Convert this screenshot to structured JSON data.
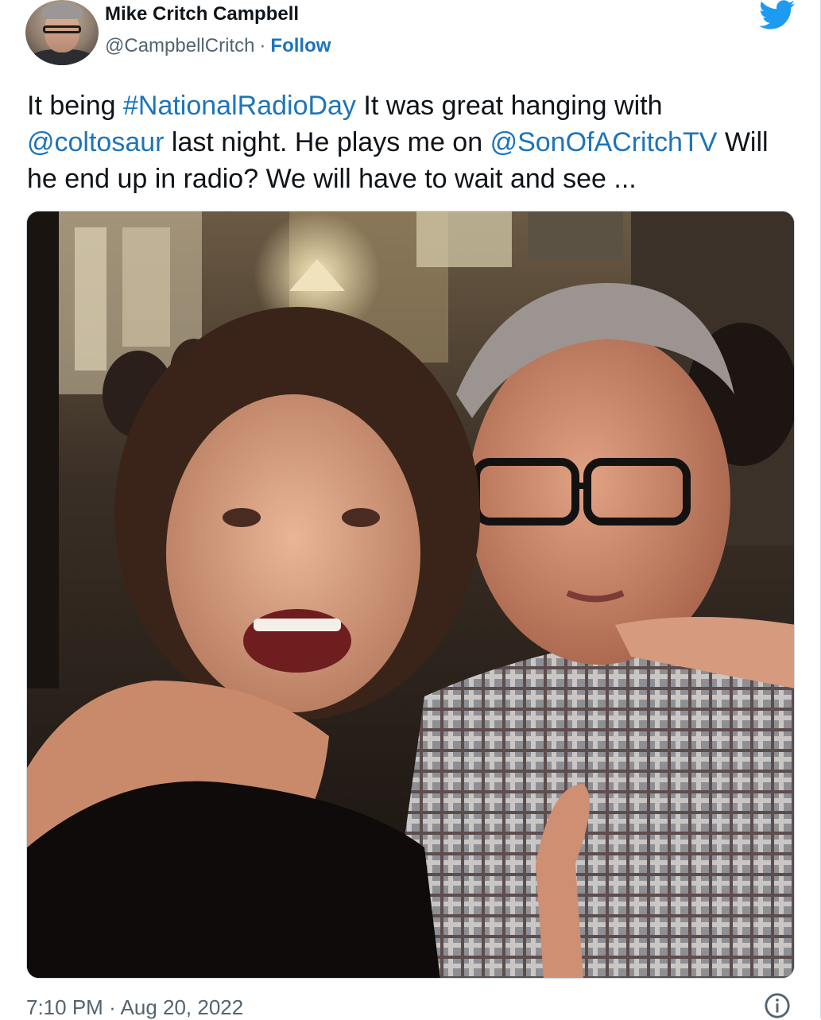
{
  "author": {
    "display_name": "Mike Critch Campbell",
    "handle": "@CampbellCritch",
    "separator": "·",
    "follow_label": "Follow"
  },
  "icons": {
    "brand": "twitter-bird-icon",
    "info": "info-icon"
  },
  "tweet": {
    "segments": [
      {
        "type": "text",
        "value": "It being "
      },
      {
        "type": "hashtag",
        "value": "#NationalRadioDay"
      },
      {
        "type": "text",
        "value": " It was great hanging with "
      },
      {
        "type": "mention",
        "value": "@coltosaur"
      },
      {
        "type": "text",
        "value": " last night. He plays me on "
      },
      {
        "type": "mention",
        "value": "@SonOfACritchTV"
      },
      {
        "type": "text",
        "value": " Will he end up in radio? We will have to wait and see ..."
      }
    ]
  },
  "meta": {
    "time": "7:10 PM",
    "separator": "·",
    "date": "Aug 20, 2022"
  },
  "colors": {
    "link": "#1d74bb",
    "twitter_blue": "#1d9bf0",
    "text": "#0f1419",
    "secondary": "#536471"
  }
}
